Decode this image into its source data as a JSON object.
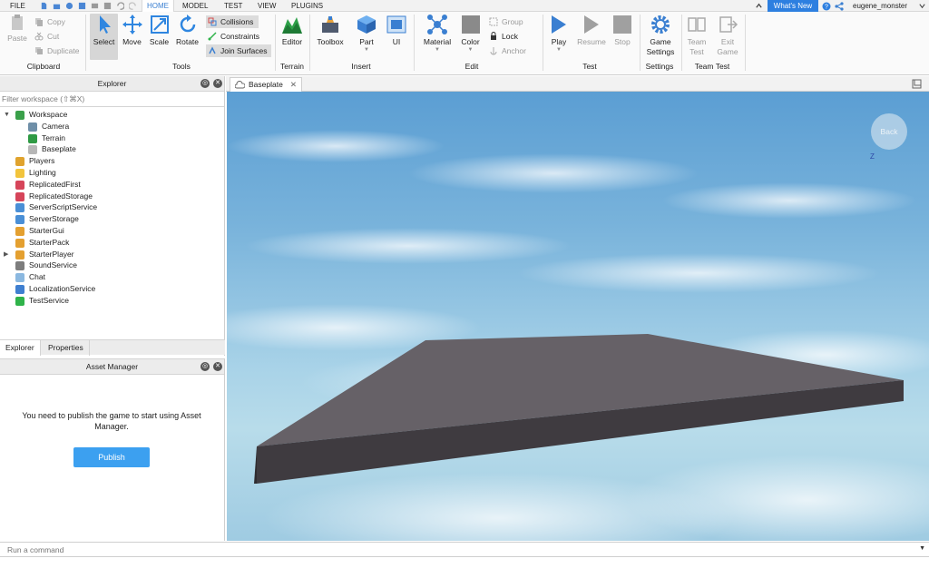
{
  "menu": {
    "items": [
      "FILE",
      "HOME",
      "MODEL",
      "TEST",
      "VIEW",
      "PLUGINS"
    ],
    "active": "HOME",
    "whats_new": "What's New",
    "username": "eugene_monster"
  },
  "ribbon": {
    "clipboard": {
      "paste": "Paste",
      "copy": "Copy",
      "cut": "Cut",
      "duplicate": "Duplicate",
      "label": "Clipboard"
    },
    "tools": {
      "select": "Select",
      "move": "Move",
      "scale": "Scale",
      "rotate": "Rotate",
      "collisions": "Collisions",
      "constraints": "Constraints",
      "join_surfaces": "Join Surfaces",
      "label": "Tools"
    },
    "terrain": {
      "editor": "Editor",
      "label": "Terrain"
    },
    "insert": {
      "toolbox": "Toolbox",
      "part": "Part",
      "ui": "UI",
      "label": "Insert"
    },
    "edit": {
      "material": "Material",
      "color": "Color",
      "group": "Group",
      "lock": "Lock",
      "anchor": "Anchor",
      "label": "Edit"
    },
    "test": {
      "play": "Play",
      "resume": "Resume",
      "stop": "Stop",
      "label": "Test"
    },
    "settings": {
      "game_settings_1": "Game",
      "game_settings_2": "Settings",
      "label": "Settings"
    },
    "team_test": {
      "team_1": "Team",
      "team_2": "Test",
      "exit_1": "Exit",
      "exit_2": "Game",
      "label": "Team Test"
    }
  },
  "explorer": {
    "title": "Explorer",
    "filter_placeholder": "Filter workspace (⇧⌘X)",
    "tree": [
      {
        "label": "Workspace",
        "depth": 0,
        "expanded": true,
        "icon": "globe-icon",
        "color": "#3aa04a"
      },
      {
        "label": "Camera",
        "depth": 1,
        "icon": "camera-icon",
        "color": "#6f8fa8"
      },
      {
        "label": "Terrain",
        "depth": 1,
        "icon": "terrain-icon",
        "color": "#2f9a44"
      },
      {
        "label": "Baseplate",
        "depth": 1,
        "icon": "part-icon",
        "color": "#b7b7b7"
      },
      {
        "label": "Players",
        "depth": 0,
        "icon": "players-icon",
        "color": "#e0a32e"
      },
      {
        "label": "Lighting",
        "depth": 0,
        "icon": "lightbulb-icon",
        "color": "#f2c43c"
      },
      {
        "label": "ReplicatedFirst",
        "depth": 0,
        "icon": "replicated-first-icon",
        "color": "#d6455a"
      },
      {
        "label": "ReplicatedStorage",
        "depth": 0,
        "icon": "replicated-storage-icon",
        "color": "#d6455a"
      },
      {
        "label": "ServerScriptService",
        "depth": 0,
        "icon": "server-script-icon",
        "color": "#4a8fd6"
      },
      {
        "label": "ServerStorage",
        "depth": 0,
        "icon": "server-storage-icon",
        "color": "#4a8fd6"
      },
      {
        "label": "StarterGui",
        "depth": 0,
        "icon": "starter-gui-icon",
        "color": "#e4a030"
      },
      {
        "label": "StarterPack",
        "depth": 0,
        "icon": "starter-pack-icon",
        "color": "#e4a030"
      },
      {
        "label": "StarterPlayer",
        "depth": 0,
        "expandable": true,
        "icon": "starter-player-icon",
        "color": "#e4a030"
      },
      {
        "label": "SoundService",
        "depth": 0,
        "icon": "speaker-icon",
        "color": "#7d7d7d"
      },
      {
        "label": "Chat",
        "depth": 0,
        "icon": "chat-icon",
        "color": "#8bb8e0"
      },
      {
        "label": "LocalizationService",
        "depth": 0,
        "icon": "localization-icon",
        "color": "#3f7fd0"
      },
      {
        "label": "TestService",
        "depth": 0,
        "icon": "check-icon",
        "color": "#2fb34a"
      }
    ],
    "tabs": [
      "Explorer",
      "Properties"
    ]
  },
  "asset_manager": {
    "title": "Asset Manager",
    "message": "You need to publish the game to start using Asset Manager.",
    "publish": "Publish"
  },
  "viewport": {
    "tab": "Baseplate",
    "back": "Back",
    "axis": "Z"
  },
  "command": {
    "placeholder": "Run a command"
  },
  "colors": {
    "accent": "#3a7fd1",
    "publish": "#3ca0f0",
    "baseplate": "#5d5960"
  }
}
